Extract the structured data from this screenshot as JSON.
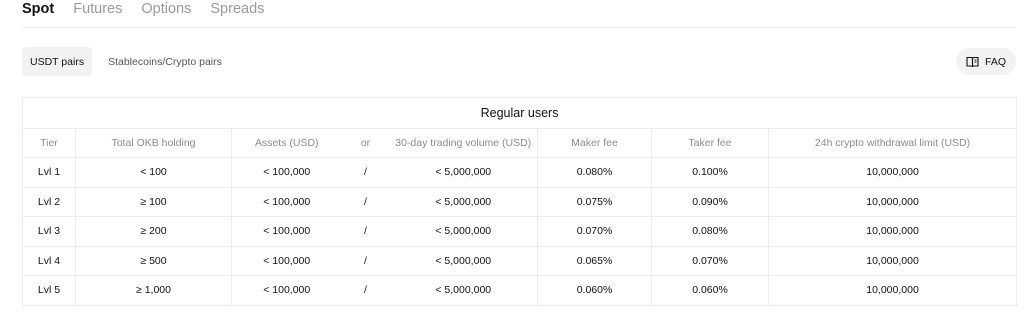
{
  "tabs": [
    {
      "label": "Spot",
      "active": true
    },
    {
      "label": "Futures",
      "active": false
    },
    {
      "label": "Options",
      "active": false
    },
    {
      "label": "Spreads",
      "active": false
    }
  ],
  "sub_tabs": [
    {
      "label": "USDT pairs",
      "active": true
    },
    {
      "label": "Stablecoins/Crypto pairs",
      "active": false
    }
  ],
  "faq": {
    "label": "FAQ",
    "icon": "book-icon"
  },
  "table": {
    "group_title": "Regular users",
    "headers": {
      "tier": "Tier",
      "okb": "Total OKB holding",
      "assets": "Assets (USD)",
      "or": "or",
      "volume": "30-day trading volume (USD)",
      "maker": "Maker fee",
      "taker": "Taker fee",
      "withdrawal": "24h crypto withdrawal limit (USD)"
    },
    "rows": [
      {
        "tier": "Lvl 1",
        "okb": "< 100",
        "assets": "< 100,000",
        "sep": "/",
        "volume": "< 5,000,000",
        "maker": "0.080%",
        "taker": "0.100%",
        "withdrawal": "10,000,000"
      },
      {
        "tier": "Lvl 2",
        "okb": "≥ 100",
        "assets": "< 100,000",
        "sep": "/",
        "volume": "< 5,000,000",
        "maker": "0.075%",
        "taker": "0.090%",
        "withdrawal": "10,000,000"
      },
      {
        "tier": "Lvl 3",
        "okb": "≥ 200",
        "assets": "< 100,000",
        "sep": "/",
        "volume": "< 5,000,000",
        "maker": "0.070%",
        "taker": "0.080%",
        "withdrawal": "10,000,000"
      },
      {
        "tier": "Lvl 4",
        "okb": "≥ 500",
        "assets": "< 100,000",
        "sep": "/",
        "volume": "< 5,000,000",
        "maker": "0.065%",
        "taker": "0.070%",
        "withdrawal": "10,000,000"
      },
      {
        "tier": "Lvl 5",
        "okb": "≥ 1,000",
        "assets": "< 100,000",
        "sep": "/",
        "volume": "< 5,000,000",
        "maker": "0.060%",
        "taker": "0.060%",
        "withdrawal": "10,000,000"
      }
    ]
  }
}
